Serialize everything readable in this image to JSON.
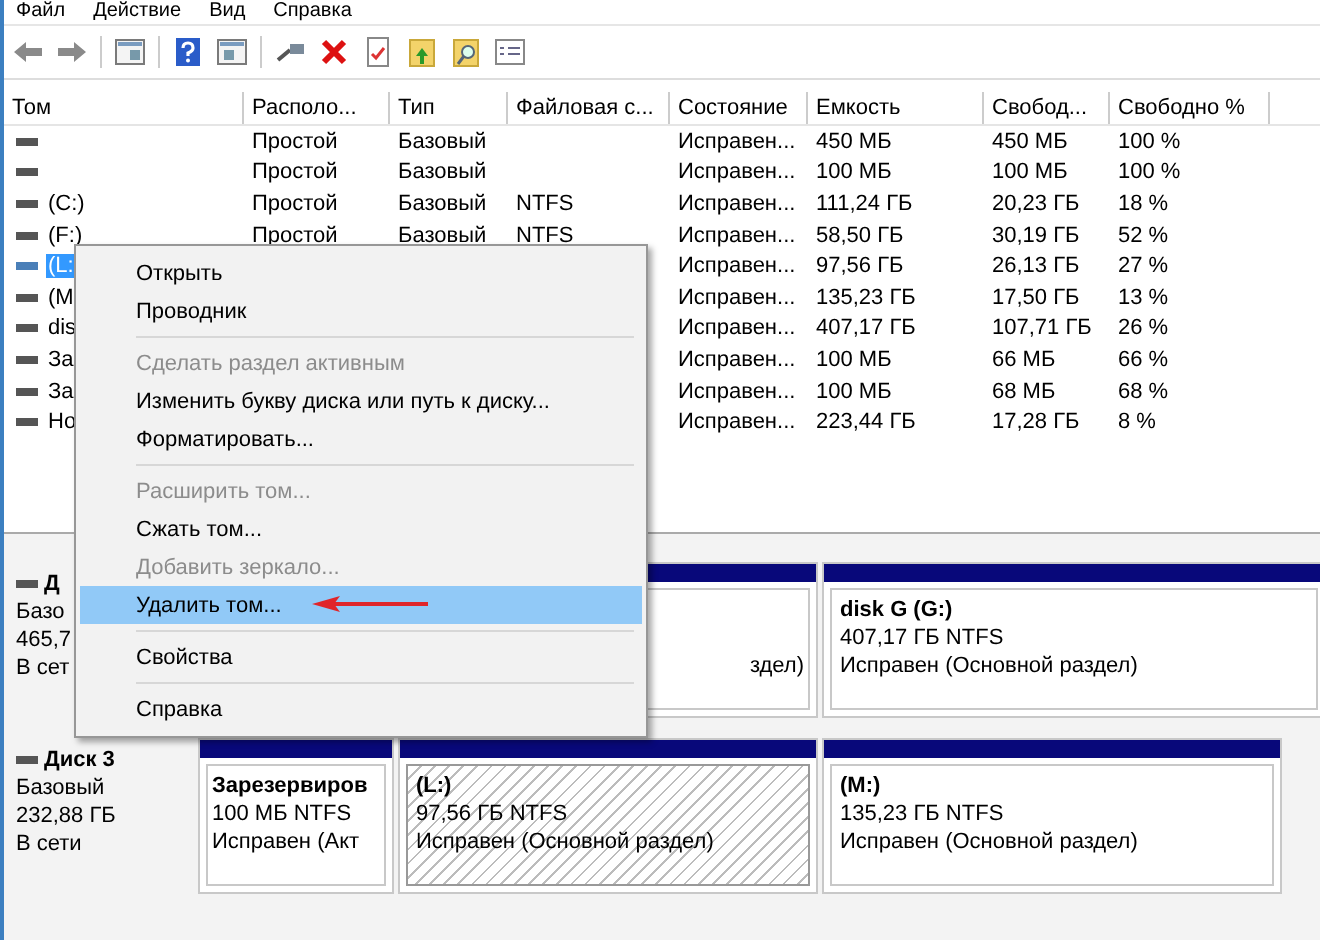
{
  "menu_bar": [
    "Файл",
    "Действие",
    "Вид",
    "Справка"
  ],
  "table": {
    "columns": [
      "Том",
      "Располо...",
      "Тип",
      "Файловая с...",
      "Состояние",
      "Емкость",
      "Свобод...",
      "Свободно %"
    ],
    "rows": [
      {
        "selected": false,
        "cells": [
          "",
          "Простой",
          "Базовый",
          "",
          "Исправен...",
          "450 МБ",
          "450 МБ",
          "100 %"
        ]
      },
      {
        "selected": false,
        "cells": [
          "",
          "Простой",
          "Базовый",
          "",
          "Исправен...",
          "100 МБ",
          "100 МБ",
          "100 %"
        ]
      },
      {
        "selected": false,
        "cells": [
          "(C:)",
          "Простой",
          "Базовый",
          "NTFS",
          "Исправен...",
          "111,24 ГБ",
          "20,23 ГБ",
          "18 %"
        ]
      },
      {
        "selected": false,
        "cells": [
          "(F:)",
          "Простой",
          "Базовый",
          "NTFS",
          "Исправен...",
          "58,50 ГБ",
          "30,19 ГБ",
          "52 %"
        ]
      },
      {
        "selected": true,
        "cells": [
          "(L:",
          "",
          "",
          "",
          "Исправен...",
          "97,56 ГБ",
          "26,13 ГБ",
          "27 %"
        ]
      },
      {
        "selected": false,
        "cells": [
          "(M",
          "",
          "",
          "",
          "Исправен...",
          "135,23 ГБ",
          "17,50 ГБ",
          "13 %"
        ]
      },
      {
        "selected": false,
        "cells": [
          "dis",
          "",
          "",
          "",
          "Исправен...",
          "407,17 ГБ",
          "107,71 ГБ",
          "26 %"
        ]
      },
      {
        "selected": false,
        "cells": [
          "За",
          "",
          "",
          "",
          "Исправен...",
          "100 МБ",
          "66 МБ",
          "66 %"
        ]
      },
      {
        "selected": false,
        "cells": [
          "За",
          "",
          "",
          "",
          "Исправен...",
          "100 МБ",
          "68 МБ",
          "68 %"
        ]
      },
      {
        "selected": false,
        "cells": [
          "Но",
          "",
          "",
          "",
          "Исправен...",
          "223,44 ГБ",
          "17,28 ГБ",
          "8 %"
        ]
      }
    ]
  },
  "disks": [
    {
      "name": "Д",
      "lines": [
        "Базо",
        "465,7",
        "В сет"
      ],
      "partitions": [
        {
          "covered": true,
          "selected": false,
          "status": "здел)"
        },
        {
          "covered": false,
          "selected": false,
          "name": "disk G  (G:)",
          "size": "407,17 ГБ NTFS",
          "status": "Исправен (Основной раздел)"
        }
      ]
    },
    {
      "name": "Диск 3",
      "lines": [
        "Базовый",
        "232,88 ГБ",
        "В сети"
      ],
      "partitions": [
        {
          "covered": false,
          "selected": false,
          "name": "Зарезервиров",
          "size": "100 МБ NTFS",
          "status": "Исправен (Акт"
        },
        {
          "covered": false,
          "selected": true,
          "name": "(L:)",
          "size": "97,56 ГБ NTFS",
          "status": "Исправен (Основной раздел)"
        },
        {
          "covered": false,
          "selected": false,
          "name": "(M:)",
          "size": "135,23 ГБ NTFS",
          "status": "Исправен (Основной раздел)"
        }
      ]
    }
  ],
  "context_menu": [
    {
      "kind": "item",
      "label": "Открыть",
      "disabled": false,
      "selected": false,
      "marked": false
    },
    {
      "kind": "item",
      "label": "Проводник",
      "disabled": false,
      "selected": false,
      "marked": false
    },
    {
      "kind": "separator"
    },
    {
      "kind": "item",
      "label": "Сделать раздел активным",
      "disabled": true,
      "selected": false,
      "marked": false
    },
    {
      "kind": "item",
      "label": "Изменить букву диска или путь к диску...",
      "disabled": false,
      "selected": false,
      "marked": false
    },
    {
      "kind": "item",
      "label": "Форматировать...",
      "disabled": false,
      "selected": false,
      "marked": false
    },
    {
      "kind": "separator"
    },
    {
      "kind": "item",
      "label": "Расширить том...",
      "disabled": true,
      "selected": false,
      "marked": false
    },
    {
      "kind": "item",
      "label": "Сжать том...",
      "disabled": false,
      "selected": false,
      "marked": false
    },
    {
      "kind": "item",
      "label": "Добавить зеркало...",
      "disabled": true,
      "selected": false,
      "marked": false
    },
    {
      "kind": "item",
      "label": "Удалить том...",
      "disabled": false,
      "selected": true,
      "marked": true
    },
    {
      "kind": "separator"
    },
    {
      "kind": "item",
      "label": "Свойства",
      "disabled": false,
      "selected": false,
      "marked": false
    },
    {
      "kind": "separator"
    },
    {
      "kind": "item",
      "label": "Справка",
      "disabled": false,
      "selected": false,
      "marked": false
    }
  ]
}
